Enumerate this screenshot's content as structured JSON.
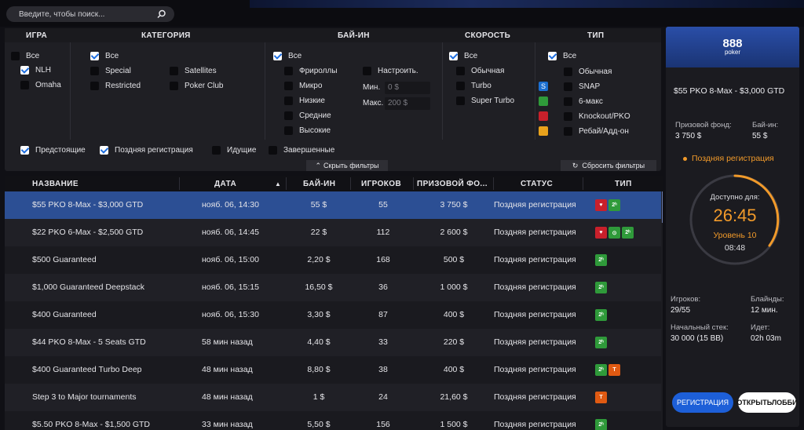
{
  "search": {
    "placeholder": "Введите, чтобы поиск..."
  },
  "filters": {
    "headers": [
      "ИГРА",
      "КАТЕГОРИЯ",
      "БАЙ-ИН",
      "СКОРОСТЬ",
      "ТИП"
    ],
    "game": [
      "Все",
      "NLH",
      "Omaha"
    ],
    "category": [
      "Все",
      "Special",
      "Restricted",
      "Satellites",
      "Poker Club"
    ],
    "buyin": [
      "Все",
      "Фрироллы",
      "Микро",
      "Низкие",
      "Средние",
      "Высокие"
    ],
    "buyin_custom": {
      "label": "Настроить.",
      "min_label": "Мин.",
      "min_value": "0 $",
      "max_label": "Макс.",
      "max_value": "200 $"
    },
    "speed": [
      "Все",
      "Обычная",
      "Turbo",
      "Super Turbo"
    ],
    "type": [
      "Все",
      "Обычная",
      "SNAP",
      "6-макс",
      "Knockout/PKO",
      "Ребай/Адд-он"
    ],
    "status": [
      "Предстоящие",
      "Поздняя регистрация",
      "Идущие",
      "Завершенные"
    ],
    "hide_label": "Скрыть фильтры",
    "reset_label": "Сбросить фильтры"
  },
  "table": {
    "columns": [
      "НАЗВАНИЕ",
      "ДАТА",
      "БАЙ-ИН",
      "ИГРОКОВ",
      "ПРИЗОВОЙ ФО...",
      "СТАТУС",
      "ТИП"
    ],
    "sort_indicator": "▲",
    "rows": [
      {
        "name": "$55 PKO 8-Max - $3,000 GTD",
        "date": "нояб. 06, 14:30",
        "buyin": "55 $",
        "players": "55",
        "prize": "3 750 $",
        "status": "Поздняя регистрация",
        "types": [
          "pko",
          "2"
        ]
      },
      {
        "name": "$22 PKO 6-Max - $2,500 GTD",
        "date": "нояб. 06, 14:45",
        "buyin": "22 $",
        "players": "112",
        "prize": "2 600 $",
        "status": "Поздняя регистрация",
        "types": [
          "pko",
          "6",
          "2"
        ]
      },
      {
        "name": "$500 Guaranteed",
        "date": "нояб. 06, 15:00",
        "buyin": "2,20 $",
        "players": "168",
        "prize": "500 $",
        "status": "Поздняя регистрация",
        "types": [
          "2"
        ]
      },
      {
        "name": "$1,000 Guaranteed Deepstack",
        "date": "нояб. 06, 15:15",
        "buyin": "16,50 $",
        "players": "36",
        "prize": "1 000 $",
        "status": "Поздняя регистрация",
        "types": [
          "2"
        ]
      },
      {
        "name": "$400 Guaranteed",
        "date": "нояб. 06, 15:30",
        "buyin": "3,30 $",
        "players": "87",
        "prize": "400 $",
        "status": "Поздняя регистрация",
        "types": [
          "2"
        ]
      },
      {
        "name": "$44 PKO 8-Max - 5 Seats GTD",
        "date": "58 мин назад",
        "buyin": "4,40 $",
        "players": "33",
        "prize": "220 $",
        "status": "Поздняя регистрация",
        "types": [
          "2"
        ]
      },
      {
        "name": "$400 Guaranteed Turbo Deep",
        "date": "48 мин назад",
        "buyin": "8,80 $",
        "players": "38",
        "prize": "400 $",
        "status": "Поздняя регистрация",
        "types": [
          "2",
          "T"
        ]
      },
      {
        "name": "Step 3 to Major tournaments",
        "date": "48 мин назад",
        "buyin": "1 $",
        "players": "24",
        "prize": "21,60 $",
        "status": "Поздняя регистрация",
        "types": [
          "T"
        ]
      },
      {
        "name": "$5.50 PKO 8-Max - $1,500 GTD",
        "date": "33 мин назад",
        "buyin": "5,50 $",
        "players": "156",
        "prize": "1 500 $",
        "status": "Поздняя регистрация",
        "types": [
          "2"
        ]
      }
    ]
  },
  "details": {
    "logo_top": "888",
    "logo_bottom": "poker",
    "title": "$55 PKO 8-Max - $3,000 GTD",
    "prize_label": "Призовой фонд:",
    "prize_value": "3 750 $",
    "buyin_label": "Бай-ин:",
    "buyin_value": "55 $",
    "late_reg": "Поздняя регистрация",
    "available_label": "Доступно для:",
    "timer": "26:45",
    "level": "Уровень 10",
    "level_time": "08:48",
    "players_label": "Игроков:",
    "players_value": "29/55",
    "blinds_label": "Блайнды:",
    "blinds_value": "12 мин.",
    "stack_label": "Начальный стек:",
    "stack_value": "30 000 (15 BB)",
    "running_label": "Идет:",
    "running_value": "02h 03m",
    "register_label": "РЕГИСТРАЦИЯ",
    "lobby_label": "ОТКРЫТЬЛОББИ"
  },
  "colors": {
    "accent": "#1d5fd8",
    "late": "#f19a2a",
    "selected_row": "#2c4f94"
  }
}
